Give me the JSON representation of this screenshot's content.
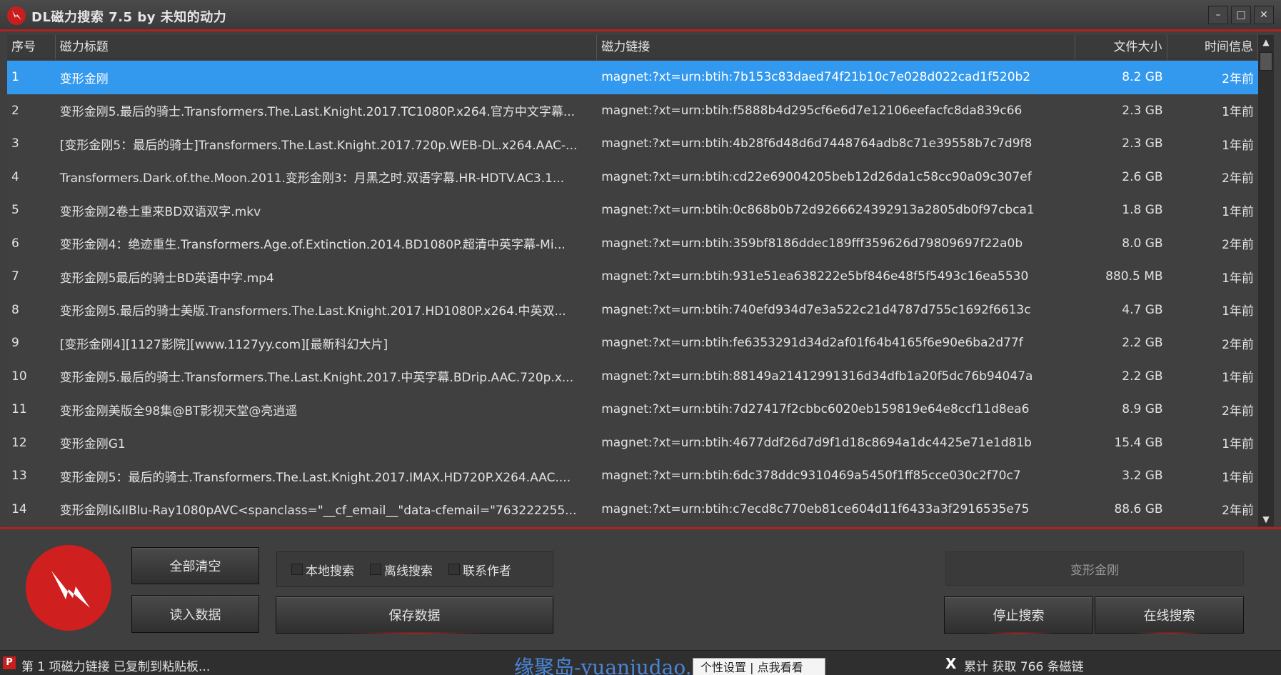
{
  "window": {
    "title": "DL磁力搜索 7.5 by 未知的动力",
    "minimize_label": "–",
    "maximize_label": "□",
    "close_label": "✕"
  },
  "table": {
    "headers": [
      "序号",
      "磁力标题",
      "磁力链接",
      "文件大小",
      "时间信息"
    ],
    "rows": [
      {
        "no": "1",
        "title": "变形金刚",
        "link": "magnet:?xt=urn:btih:7b153c83daed74f21b10c7e028d022cad1f520b2",
        "size": "8.2 GB",
        "time": "2年前"
      },
      {
        "no": "2",
        "title": "变形金刚5.最后的骑士.Transformers.The.Last.Knight.2017.TC1080P.x264.官方中文字幕...",
        "link": "magnet:?xt=urn:btih:f5888b4d295cf6e6d7e12106eefacfc8da839c66",
        "size": "2.3 GB",
        "time": "1年前"
      },
      {
        "no": "3",
        "title": "[变形金刚5：最后的骑士]Transformers.The.Last.Knight.2017.720p.WEB-DL.x264.AAC-...",
        "link": "magnet:?xt=urn:btih:4b28f6d48d6d7448764adb8c71e39558b7c7d9f8",
        "size": "2.3 GB",
        "time": "1年前"
      },
      {
        "no": "4",
        "title": "Transformers.Dark.of.the.Moon.2011.变形金刚3：月黑之时.双语字幕.HR-HDTV.AC3.1...",
        "link": "magnet:?xt=urn:btih:cd22e69004205beb12d26da1c58cc90a09c307ef",
        "size": "2.6 GB",
        "time": "2年前"
      },
      {
        "no": "5",
        "title": "变形金刚2卷土重来BD双语双字.mkv",
        "link": "magnet:?xt=urn:btih:0c868b0b72d9266624392913a2805db0f97cbca1",
        "size": "1.8 GB",
        "time": "1年前"
      },
      {
        "no": "6",
        "title": "变形金刚4：绝迹重生.Transformers.Age.of.Extinction.2014.BD1080P.超清中英字幕-Mi...",
        "link": "magnet:?xt=urn:btih:359bf8186ddec189fff359626d79809697f22a0b",
        "size": "8.0 GB",
        "time": "2年前"
      },
      {
        "no": "7",
        "title": "变形金刚5最后的骑士BD英语中字.mp4",
        "link": "magnet:?xt=urn:btih:931e51ea638222e5bf846e48f5f5493c16ea5530",
        "size": "880.5 MB",
        "time": "1年前"
      },
      {
        "no": "8",
        "title": "变形金刚5.最后的骑士美版.Transformers.The.Last.Knight.2017.HD1080P.x264.中英双...",
        "link": "magnet:?xt=urn:btih:740efd934d7e3a522c21d4787d755c1692f6613c",
        "size": "4.7 GB",
        "time": "1年前"
      },
      {
        "no": "9",
        "title": "[变形金刚4][1127影院][www.1127yy.com][最新科幻大片]",
        "link": "magnet:?xt=urn:btih:fe6353291d34d2af01f64b4165f6e90e6ba2d77f",
        "size": "2.2 GB",
        "time": "2年前"
      },
      {
        "no": "10",
        "title": "变形金刚5.最后的骑士.Transformers.The.Last.Knight.2017.中英字幕.BDrip.AAC.720p.x...",
        "link": "magnet:?xt=urn:btih:88149a21412991316d34dfb1a20f5dc76b94047a",
        "size": "2.2 GB",
        "time": "1年前"
      },
      {
        "no": "11",
        "title": "变形金刚美版全98集@BT影视天堂@亮逍遥",
        "link": "magnet:?xt=urn:btih:7d27417f2cbbc6020eb159819e64e8ccf11d8ea6",
        "size": "8.9 GB",
        "time": "2年前"
      },
      {
        "no": "12",
        "title": "变形金刚G1",
        "link": "magnet:?xt=urn:btih:4677ddf26d7d9f1d18c8694a1dc4425e71e1d81b",
        "size": "15.4 GB",
        "time": "1年前"
      },
      {
        "no": "13",
        "title": "变形金刚5：最后的骑士.Transformers.The.Last.Knight.2017.IMAX.HD720P.X264.AAC....",
        "link": "magnet:?xt=urn:btih:6dc378ddc9310469a5450f1ff85cce030c2f70c7",
        "size": "3.2 GB",
        "time": "1年前"
      },
      {
        "no": "14",
        "title": "变形金刚I&IIBlu-Ray1080pAVC<spanclass=\"__cf_email__\"data-cfemail=\"763222255...",
        "link": "magnet:?xt=urn:btih:c7ecd8c770eb81ce604d11f6433a3f2916535e75",
        "size": "88.6 GB",
        "time": "2年前"
      }
    ]
  },
  "controls": {
    "clear_all": "全部清空",
    "load_data": "读入数据",
    "save_data": "保存数据",
    "local_search": "本地搜索",
    "offline_search": "离线搜索",
    "contact_author": "联系作者",
    "search_value": "变形金刚",
    "stop_search": "停止搜索",
    "online_search": "在线搜索"
  },
  "status": {
    "icon_letter": "P",
    "message": "第 1 项磁力链接 已复制到粘贴板...",
    "watermark": "缘聚岛-yuanjudao.com",
    "tooltip": "个性设置 | 点我看看",
    "close_mark": "X",
    "count": "累计 获取 766 条磁链"
  },
  "colors": {
    "accent_red": "#b32020",
    "selection_blue": "#3399ee",
    "background": "#3f3f3f"
  }
}
